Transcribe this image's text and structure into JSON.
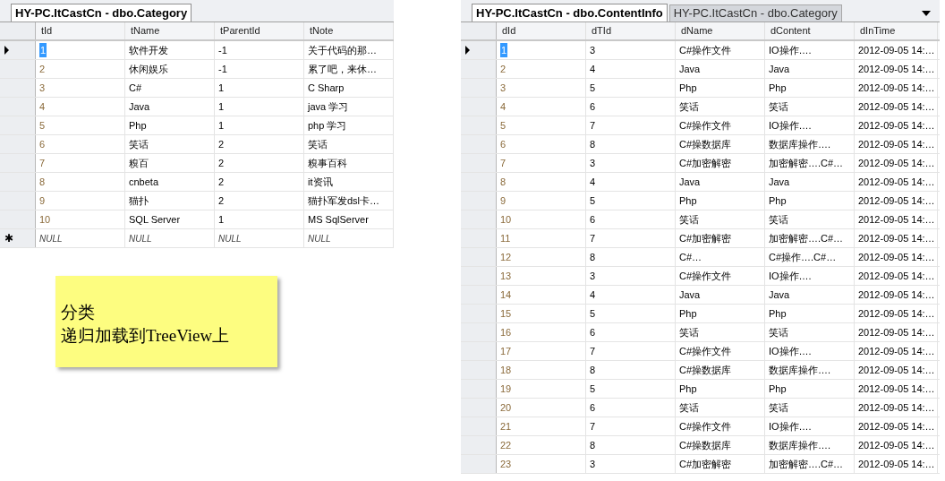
{
  "left_pane": {
    "tabs": [
      {
        "label": "HY-PC.ItCastCn - dbo.Category",
        "selected": true
      }
    ],
    "columns": [
      "tId",
      "tName",
      "tParentId",
      "tNote"
    ],
    "rows": [
      {
        "kind": "data",
        "selected": true,
        "cells": [
          "1",
          "软件开发",
          "-1",
          "关于代码的那…"
        ]
      },
      {
        "kind": "data",
        "selected": false,
        "cells": [
          "2",
          "休闲娱乐",
          "-1",
          "累了吧，来休…"
        ]
      },
      {
        "kind": "data",
        "selected": false,
        "cells": [
          "3",
          "C#",
          "1",
          "C Sharp"
        ]
      },
      {
        "kind": "data",
        "selected": false,
        "cells": [
          "4",
          "Java",
          "1",
          "java 学习"
        ]
      },
      {
        "kind": "data",
        "selected": false,
        "cells": [
          "5",
          "Php",
          "1",
          "php 学习"
        ]
      },
      {
        "kind": "data",
        "selected": false,
        "cells": [
          "6",
          "笑话",
          "2",
          "笑话"
        ]
      },
      {
        "kind": "data",
        "selected": false,
        "cells": [
          "7",
          "糗百",
          "2",
          "糗事百科"
        ]
      },
      {
        "kind": "data",
        "selected": false,
        "cells": [
          "8",
          "cnbeta",
          "2",
          "it资讯"
        ]
      },
      {
        "kind": "data",
        "selected": false,
        "cells": [
          "9",
          "猫扑",
          "2",
          "猫扑军发dsl卡…"
        ]
      },
      {
        "kind": "data",
        "selected": false,
        "cells": [
          "10",
          "SQL Server",
          "1",
          "MS SqlServer"
        ]
      },
      {
        "kind": "new",
        "selected": false,
        "marker": "✱",
        "cells": [
          "NULL",
          "NULL",
          "NULL",
          "NULL"
        ]
      }
    ]
  },
  "note": {
    "lines": [
      "分类",
      "递归加载到TreeView上"
    ]
  },
  "right_pane": {
    "tabs": [
      {
        "label": "HY-PC.ItCastCn - dbo.ContentInfo",
        "selected": true
      },
      {
        "label": "HY-PC.ItCastCn - dbo.Category",
        "selected": false
      }
    ],
    "columns": [
      "dId",
      "dTId",
      "dName",
      "dContent",
      "dInTime"
    ],
    "rows": [
      {
        "kind": "data",
        "selected": true,
        "cells": [
          "1",
          "3",
          "C#操作文件",
          "IO操作….",
          "2012-09-05 14:…"
        ]
      },
      {
        "kind": "data",
        "selected": false,
        "cells": [
          "2",
          "4",
          "Java",
          "Java",
          "2012-09-05 14:…"
        ]
      },
      {
        "kind": "data",
        "selected": false,
        "cells": [
          "3",
          "5",
          "Php",
          "Php",
          "2012-09-05 14:…"
        ]
      },
      {
        "kind": "data",
        "selected": false,
        "cells": [
          "4",
          "6",
          "笑话",
          "笑话",
          "2012-09-05 14:…"
        ]
      },
      {
        "kind": "data",
        "selected": false,
        "cells": [
          "5",
          "7",
          "C#操作文件",
          "IO操作….",
          "2012-09-05 14:…"
        ]
      },
      {
        "kind": "data",
        "selected": false,
        "cells": [
          "6",
          "8",
          "C#操数据库",
          "数据库操作….",
          "2012-09-05 14:…"
        ]
      },
      {
        "kind": "data",
        "selected": false,
        "cells": [
          "7",
          "3",
          "C#加密解密",
          "加密解密….C#…",
          "2012-09-05 14:…"
        ]
      },
      {
        "kind": "data",
        "selected": false,
        "cells": [
          "8",
          "4",
          "Java",
          "Java",
          "2012-09-05 14:…"
        ]
      },
      {
        "kind": "data",
        "selected": false,
        "cells": [
          "9",
          "5",
          "Php",
          "Php",
          "2012-09-05 14:…"
        ]
      },
      {
        "kind": "data",
        "selected": false,
        "cells": [
          "10",
          "6",
          "笑话",
          "笑话",
          "2012-09-05 14:…"
        ]
      },
      {
        "kind": "data",
        "selected": false,
        "cells": [
          "11",
          "7",
          "C#加密解密",
          "加密解密….C#…",
          "2012-09-05 14:…"
        ]
      },
      {
        "kind": "data",
        "selected": false,
        "cells": [
          "12",
          "8",
          "C#…",
          "C#操作….C#…",
          "2012-09-05 14:…"
        ]
      },
      {
        "kind": "data",
        "selected": false,
        "cells": [
          "13",
          "3",
          "C#操作文件",
          "IO操作….",
          "2012-09-05 14:…"
        ]
      },
      {
        "kind": "data",
        "selected": false,
        "cells": [
          "14",
          "4",
          "Java",
          "Java",
          "2012-09-05 14:…"
        ]
      },
      {
        "kind": "data",
        "selected": false,
        "cells": [
          "15",
          "5",
          "Php",
          "Php",
          "2012-09-05 14:…"
        ]
      },
      {
        "kind": "data",
        "selected": false,
        "cells": [
          "16",
          "6",
          "笑话",
          "笑话",
          "2012-09-05 14:…"
        ]
      },
      {
        "kind": "data",
        "selected": false,
        "cells": [
          "17",
          "7",
          "C#操作文件",
          "IO操作….",
          "2012-09-05 14:…"
        ]
      },
      {
        "kind": "data",
        "selected": false,
        "cells": [
          "18",
          "8",
          "C#操数据库",
          "数据库操作….",
          "2012-09-05 14:…"
        ]
      },
      {
        "kind": "data",
        "selected": false,
        "cells": [
          "19",
          "5",
          "Php",
          "Php",
          "2012-09-05 14:…"
        ]
      },
      {
        "kind": "data",
        "selected": false,
        "cells": [
          "20",
          "6",
          "笑话",
          "笑话",
          "2012-09-05 14:…"
        ]
      },
      {
        "kind": "data",
        "selected": false,
        "cells": [
          "21",
          "7",
          "C#操作文件",
          "IO操作….",
          "2012-09-05 14:…"
        ]
      },
      {
        "kind": "data",
        "selected": false,
        "cells": [
          "22",
          "8",
          "C#操数据库",
          "数据库操作….",
          "2012-09-05 14:…"
        ]
      },
      {
        "kind": "data",
        "selected": false,
        "cells": [
          "23",
          "3",
          "C#加密解密",
          "加密解密….C#…",
          "2012-09-05 14:…"
        ]
      }
    ]
  }
}
